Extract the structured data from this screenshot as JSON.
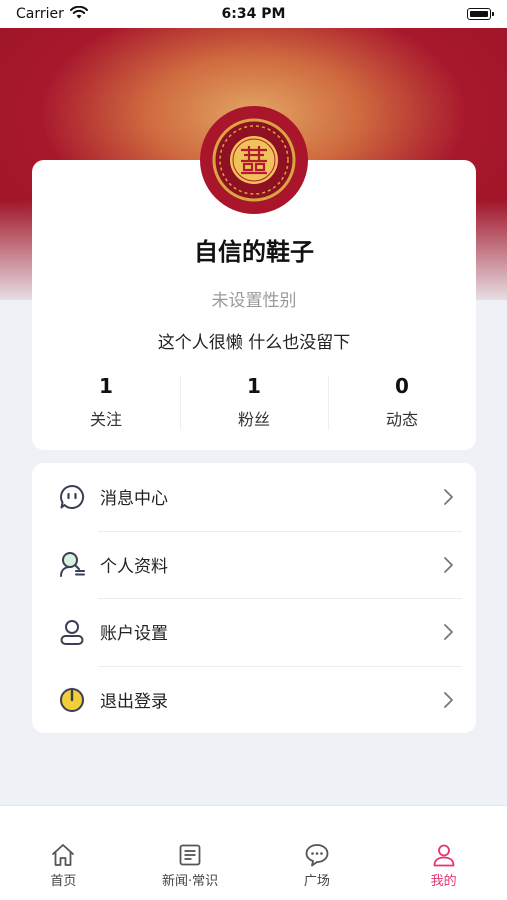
{
  "status_bar": {
    "carrier": "Carrier",
    "time": "6:34 PM"
  },
  "profile": {
    "avatar_icon": "double-happiness-icon",
    "username": "自信的鞋子",
    "gender": "未设置性别",
    "bio": "这个人很懒 什么也没留下",
    "stats": [
      {
        "value": "1",
        "label": "关注"
      },
      {
        "value": "1",
        "label": "粉丝"
      },
      {
        "value": "0",
        "label": "动态"
      }
    ]
  },
  "menu": {
    "items": [
      {
        "label": "消息中心",
        "icon": "message-face-icon"
      },
      {
        "label": "个人资料",
        "icon": "profile-search-icon"
      },
      {
        "label": "账户设置",
        "icon": "user-icon"
      },
      {
        "label": "退出登录",
        "icon": "power-icon"
      }
    ]
  },
  "tabbar": {
    "tabs": [
      {
        "label": "首页",
        "icon": "home-icon"
      },
      {
        "label": "新闻·常识",
        "icon": "news-icon"
      },
      {
        "label": "广场",
        "icon": "chat-icon"
      },
      {
        "label": "我的",
        "icon": "person-icon"
      }
    ],
    "active_index": 3
  },
  "colors": {
    "hero_red": "#a8182d",
    "hero_gold": "#e2a564",
    "accent_pink": "#e8356d",
    "power_yellow": "#f2cf3a"
  }
}
